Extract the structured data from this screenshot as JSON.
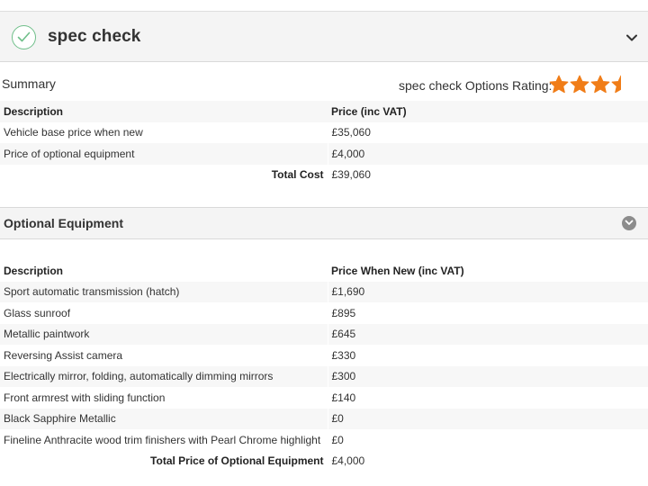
{
  "header": {
    "title": "spec check"
  },
  "summary": {
    "label": "Summary",
    "rating_label": "spec check Options Rating:",
    "rating": 3.5,
    "rating_max": 4,
    "columns": [
      "Description",
      "Price (inc VAT)"
    ],
    "rows": [
      {
        "description": "Vehicle base price when new",
        "price": "£35,060"
      },
      {
        "description": "Price of optional equipment",
        "price": "£4,000"
      }
    ],
    "total_label": "Total Cost",
    "total_value": "£39,060"
  },
  "optional": {
    "title": "Optional Equipment",
    "columns": [
      "Description",
      "Price When New (inc VAT)"
    ],
    "rows": [
      {
        "description": "Sport automatic transmission (hatch)",
        "price": "£1,690"
      },
      {
        "description": "Glass sunroof",
        "price": "£895"
      },
      {
        "description": "Metallic paintwork",
        "price": "£645"
      },
      {
        "description": "Reversing Assist camera",
        "price": "£330"
      },
      {
        "description": "Electrically mirror, folding, automatically dimming mirrors",
        "price": "£300"
      },
      {
        "description": "Front armrest with sliding function",
        "price": "£140"
      },
      {
        "description": "Black Sapphire Metallic",
        "price": "£0"
      },
      {
        "description": "Fineline Anthracite wood trim finishers with Pearl Chrome highlight",
        "price": "£0"
      }
    ],
    "total_label": "Total Price of Optional Equipment",
    "total_value": "£4,000"
  },
  "colors": {
    "star": "#f07d18",
    "check": "#6fbf8a",
    "toggle": "#8c8c8c"
  }
}
